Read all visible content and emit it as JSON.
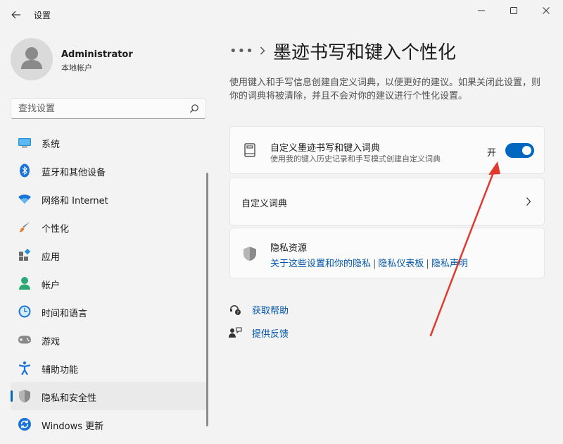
{
  "window": {
    "title": "设置"
  },
  "user": {
    "name": "Administrator",
    "account_type": "本地帐户"
  },
  "search": {
    "placeholder": "查找设置"
  },
  "sidebar": {
    "items": [
      {
        "label": "系统",
        "icon": "system-icon"
      },
      {
        "label": "蓝牙和其他设备",
        "icon": "bluetooth-icon"
      },
      {
        "label": "网络和 Internet",
        "icon": "wifi-icon"
      },
      {
        "label": "个性化",
        "icon": "brush-icon"
      },
      {
        "label": "应用",
        "icon": "apps-icon"
      },
      {
        "label": "帐户",
        "icon": "account-icon"
      },
      {
        "label": "时间和语言",
        "icon": "time-language-icon"
      },
      {
        "label": "游戏",
        "icon": "gamepad-icon"
      },
      {
        "label": "辅助功能",
        "icon": "accessibility-icon"
      },
      {
        "label": "隐私和安全性",
        "icon": "shield-icon",
        "selected": true
      },
      {
        "label": "Windows 更新",
        "icon": "update-icon"
      }
    ]
  },
  "breadcrumb": {
    "more": "•••",
    "title": "墨迹书写和键入个性化"
  },
  "main": {
    "description": "使用键入和手写信息创建自定义词典，以便更好的建议。如果关闭此设置，则你的词典将被清除，并且不会对你的建议进行个性化设置。",
    "custom_dictionary_setting": {
      "title": "自定义墨迹书写和键入词典",
      "subtitle": "使用我的键入历史记录和手写模式创建自定义词典",
      "state_label": "开",
      "enabled": true
    },
    "custom_dictionary_link": {
      "label": "自定义词典"
    },
    "privacy_resources": {
      "title": "隐私资源",
      "links": [
        "关于这些设置和你的隐私",
        "隐私仪表板",
        "隐私声明"
      ],
      "separator": "|"
    },
    "help": {
      "get_help": "获取帮助",
      "feedback": "提供反馈"
    }
  },
  "colors": {
    "accent": "#0067c0",
    "link": "#0055aa",
    "annotation_arrow": "#e03a2f"
  }
}
